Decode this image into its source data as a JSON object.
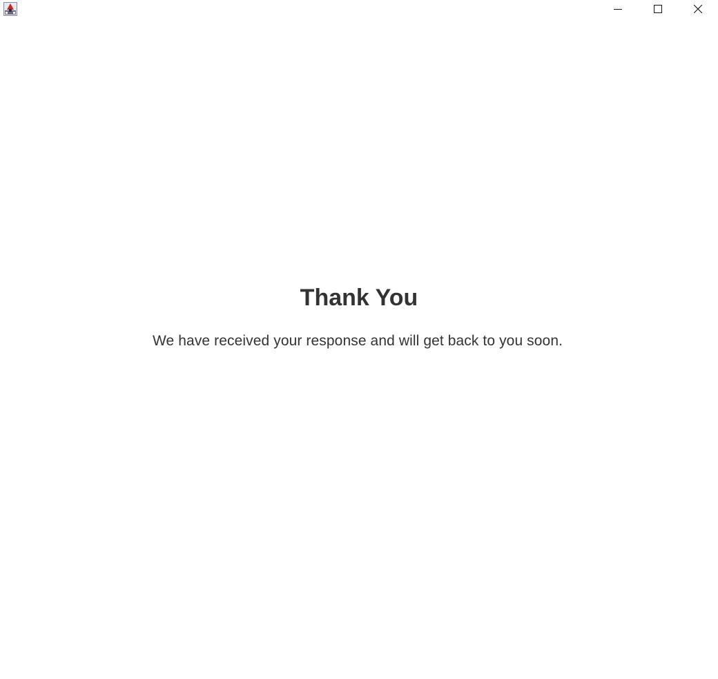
{
  "window": {
    "app_icon": "java-app-icon",
    "controls": {
      "minimize_icon": "minimize-icon",
      "maximize_icon": "maximize-icon",
      "close_icon": "close-icon"
    }
  },
  "main": {
    "heading": "Thank You",
    "message": "We have received your response and will get back to you soon."
  },
  "colors": {
    "text": "#333333",
    "background": "#ffffff"
  }
}
